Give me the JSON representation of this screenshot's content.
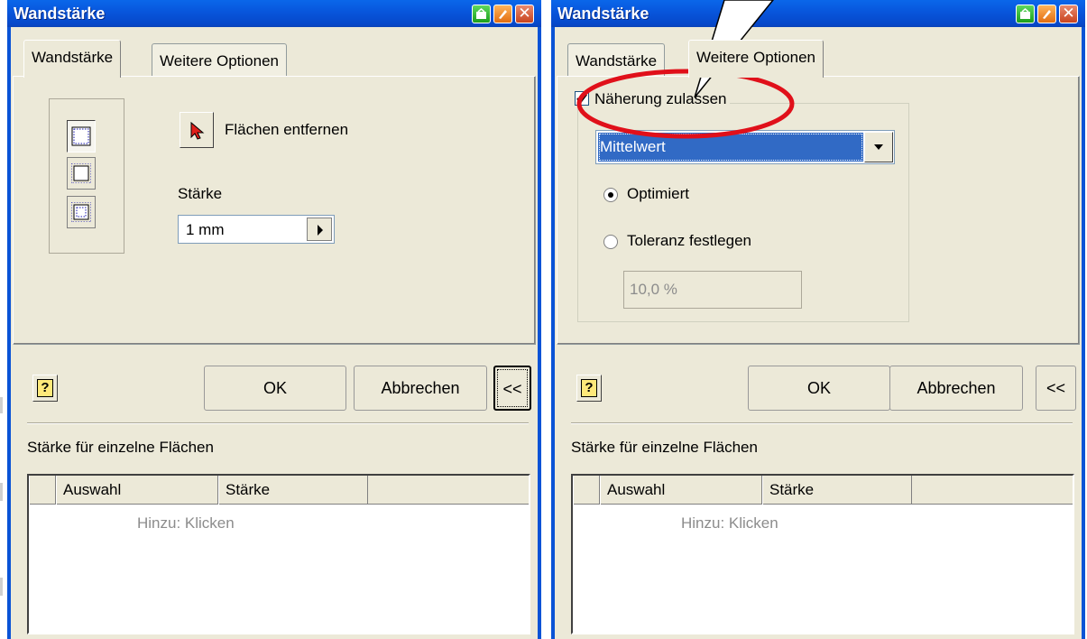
{
  "colors": {
    "title_bar": "#0a53d6",
    "dialog_bg": "#ece9d8",
    "highlight": "#316ac5",
    "annotation": "#ff0000"
  },
  "left": {
    "title": "Wandstärke",
    "tabs": [
      "Wandstärke",
      "Weitere Optionen"
    ],
    "remove_faces_label": "Flächen entfernen",
    "thickness_label": "Stärke",
    "thickness_value": "1 mm",
    "ok": "OK",
    "cancel": "Abbrechen",
    "collapse": "<<",
    "help": "?",
    "section_label": "Stärke für einzelne Flächen",
    "table_headers": [
      "Auswahl",
      "Stärke"
    ],
    "table_placeholder": "Hinzu: Klicken"
  },
  "right": {
    "title": "Wandstärke",
    "tabs": [
      "Wandstärke",
      "Weitere Optionen"
    ],
    "approx_label": "Näherung zulassen",
    "approx_checked": true,
    "approx_mode": "Mittelwert",
    "radio_optimized": "Optimiert",
    "radio_tolerance": "Toleranz festlegen",
    "tolerance_value": "10,0 %",
    "ok": "OK",
    "cancel": "Abbrechen",
    "collapse": "<<",
    "help": "?",
    "section_label": "Stärke für einzelne Flächen",
    "table_headers": [
      "Auswahl",
      "Stärke"
    ],
    "table_placeholder": "Hinzu: Klicken"
  }
}
